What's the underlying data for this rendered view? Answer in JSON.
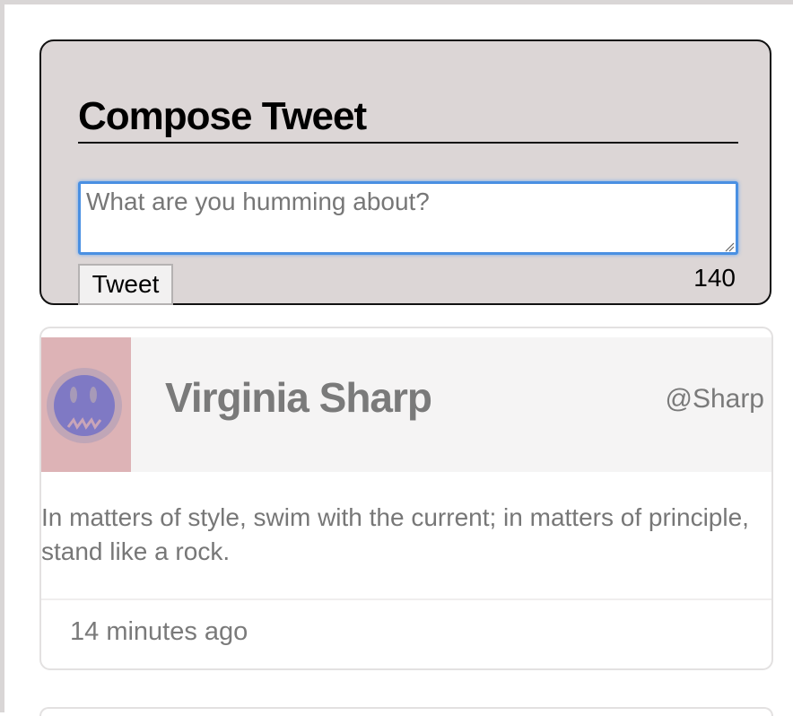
{
  "compose": {
    "title": "Compose Tweet",
    "placeholder": "What are you humming about?",
    "value": "",
    "button_label": "Tweet",
    "char_count": "140"
  },
  "tweets": [
    {
      "author_name": "Virginia Sharp",
      "handle": "@Sharp",
      "body": "In matters of style, swim with the current; in matters of principle, stand like a rock.",
      "timestamp": "14 minutes ago"
    }
  ],
  "colors": {
    "compose_bg": "#dcd6d6",
    "focus_ring": "#4a90e2",
    "card_header_bg": "#f5f4f4",
    "muted_text": "#7a7a7a",
    "avatar_bg": "#ddb3b6"
  },
  "icons": {
    "avatar": "smiley-avatar-icon",
    "resize": "resize-grip-icon"
  }
}
